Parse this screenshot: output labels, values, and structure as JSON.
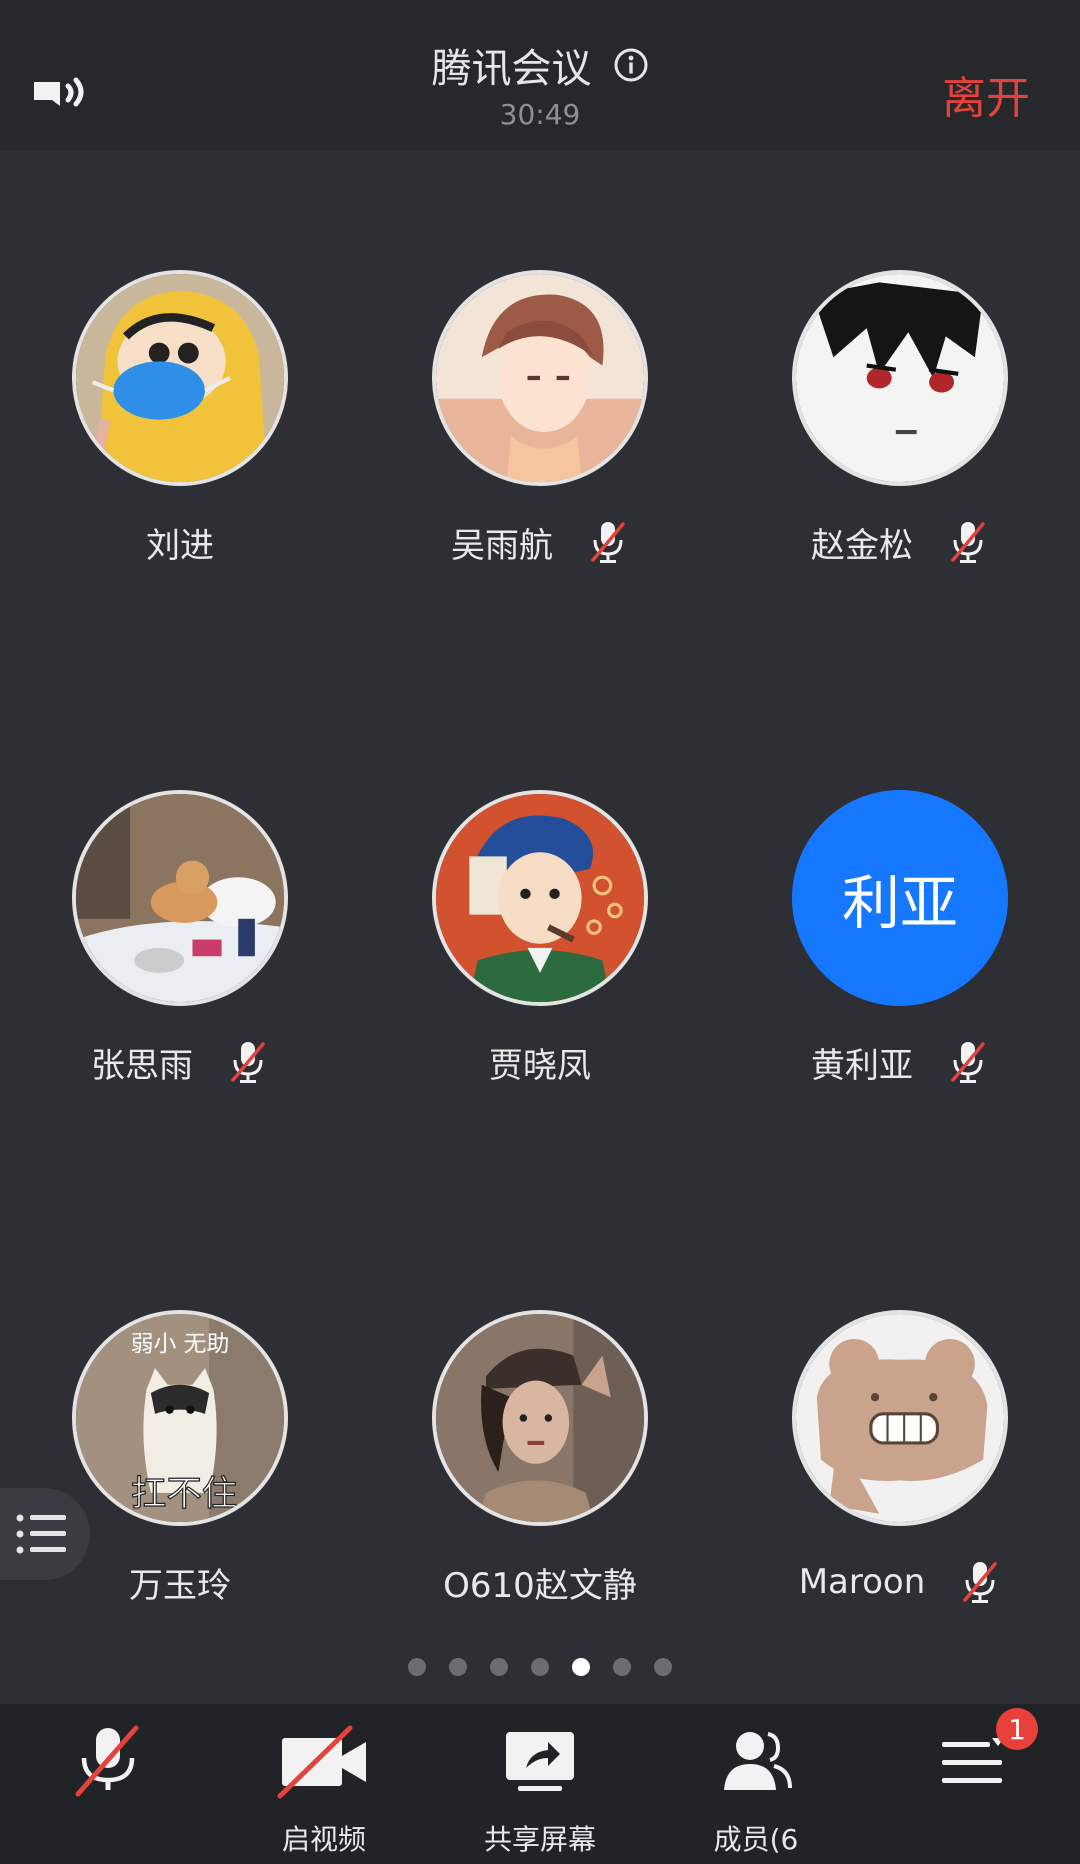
{
  "header": {
    "title": "腾讯会议",
    "timer": "30:49",
    "leave_label": "离开"
  },
  "participants": [
    {
      "name": "刘进",
      "muted": false,
      "avatar": "cartoon-boy-yellow-raincoat-mask"
    },
    {
      "name": "吴雨航",
      "muted": true,
      "avatar": "anime-boy-brown-hair"
    },
    {
      "name": "赵金松",
      "muted": true,
      "avatar": "anime-black-hair-red-eyes"
    },
    {
      "name": "张思雨",
      "muted": true,
      "avatar": "dog-lying-in-bed"
    },
    {
      "name": "贾晓凤",
      "muted": false,
      "avatar": "painted-child-fur-hat"
    },
    {
      "name": "黄利亚",
      "muted": true,
      "avatar_text": "利亚"
    },
    {
      "name": "万玉玲",
      "muted": false,
      "avatar": "cat-meme",
      "avatar_caption_top": "弱小 无助",
      "avatar_caption_bottom": "扛不住"
    },
    {
      "name": "O610赵文静",
      "muted": false,
      "avatar": "woman-with-cap-photo"
    },
    {
      "name": "Maroon",
      "muted": true,
      "avatar": "smiling-bear-meme"
    }
  ],
  "pagination": {
    "total": 7,
    "current_index": 4
  },
  "toolbar": {
    "items": [
      {
        "label": "",
        "icon": "mic-muted-icon"
      },
      {
        "label": "启视频",
        "icon": "video-off-icon"
      },
      {
        "label": "共享屏幕",
        "icon": "share-screen-icon"
      },
      {
        "label": "成员(6",
        "icon": "members-icon"
      },
      {
        "label": "",
        "icon": "more-menu-icon",
        "badge": "1"
      }
    ]
  },
  "colors": {
    "background": "#2d2f34",
    "topbar": "#26282c",
    "toolbar": "#222327",
    "leave": "#e2433a",
    "muted_red": "#e2433a",
    "avatar_blue": "#1677ff"
  }
}
